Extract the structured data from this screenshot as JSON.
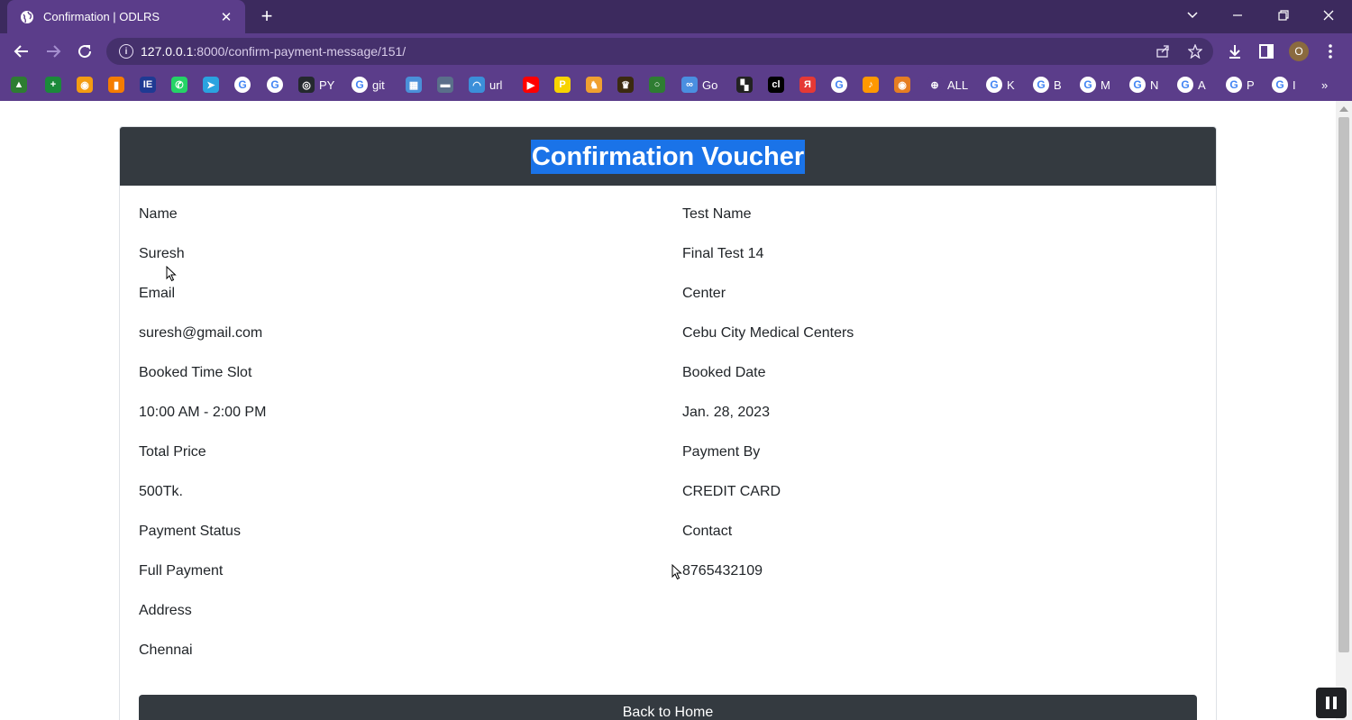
{
  "browser": {
    "tab": {
      "title": "Confirmation | ODLRS",
      "close_label": "✕"
    },
    "new_tab_label": "+",
    "url": {
      "host": "127.0.0.1",
      "path": ":8000/confirm-payment-message/151/"
    },
    "profile_initial": "O",
    "bookmarks": [
      {
        "label": "",
        "color": "#2e7d32",
        "glyph": "▲"
      },
      {
        "label": "",
        "color": "#1b8a3a",
        "glyph": "+"
      },
      {
        "label": "",
        "color": "#f39c12",
        "glyph": "◉"
      },
      {
        "label": "",
        "color": "#f57c00",
        "glyph": "▮"
      },
      {
        "label": "",
        "color": "#1f3a93",
        "glyph": "IE"
      },
      {
        "label": "",
        "color": "#25d366",
        "glyph": "✆"
      },
      {
        "label": "",
        "color": "#2aa3e0",
        "glyph": "➤"
      },
      {
        "label": "",
        "color": "g",
        "glyph": "G"
      },
      {
        "label": "",
        "color": "g",
        "glyph": "G"
      },
      {
        "label": "PY",
        "color": "#24292e",
        "glyph": "◎"
      },
      {
        "label": "git",
        "color": "g",
        "glyph": "G"
      },
      {
        "label": "",
        "color": "#4a90d9",
        "glyph": "▦"
      },
      {
        "label": "",
        "color": "#5a6f8a",
        "glyph": "▬"
      },
      {
        "label": "url",
        "color": "#3b8fd9",
        "glyph": "◠"
      },
      {
        "label": "",
        "color": "#ff0000",
        "glyph": "▶"
      },
      {
        "label": "",
        "color": "#f7d300",
        "glyph": "P"
      },
      {
        "label": "",
        "color": "#f0a030",
        "glyph": "♞"
      },
      {
        "label": "",
        "color": "#3b2a10",
        "glyph": "♛"
      },
      {
        "label": "",
        "color": "#2e7d32",
        "glyph": "○"
      },
      {
        "label": "Go",
        "color": "#4a8fe0",
        "glyph": "∞"
      },
      {
        "label": "",
        "color": "#222222",
        "glyph": "▚"
      },
      {
        "label": "",
        "color": "#000000",
        "glyph": "cl"
      },
      {
        "label": "",
        "color": "#e53935",
        "glyph": "Я"
      },
      {
        "label": "",
        "color": "g",
        "glyph": "G"
      },
      {
        "label": "",
        "color": "#ff9800",
        "glyph": "♪"
      },
      {
        "label": "",
        "color": "#e67e22",
        "glyph": "◉"
      },
      {
        "label": "ALL",
        "color": "#5b3d8a",
        "glyph": "⊕"
      },
      {
        "label": "K",
        "color": "g",
        "glyph": "G"
      },
      {
        "label": "B",
        "color": "g",
        "glyph": "G"
      },
      {
        "label": "M",
        "color": "g",
        "glyph": "G"
      },
      {
        "label": "N",
        "color": "g",
        "glyph": "G"
      },
      {
        "label": "A",
        "color": "g",
        "glyph": "G"
      },
      {
        "label": "P",
        "color": "g",
        "glyph": "G"
      },
      {
        "label": "I",
        "color": "g",
        "glyph": "G"
      }
    ],
    "overflow_label": "»"
  },
  "voucher": {
    "title": "Confirmation Voucher",
    "rows": [
      {
        "left": "Name",
        "right": "Test Name"
      },
      {
        "left": "Suresh",
        "right": "Final Test 14"
      },
      {
        "left": "Email",
        "right": "Center"
      },
      {
        "left": "suresh@gmail.com",
        "right": "Cebu City Medical Centers"
      },
      {
        "left": "Booked Time Slot",
        "right": "Booked Date"
      },
      {
        "left": "10:00 AM - 2:00 PM",
        "right": "Jan. 28, 2023"
      },
      {
        "left": "Total Price",
        "right": "Payment By"
      },
      {
        "left": "500Tk.",
        "right": "CREDIT CARD"
      },
      {
        "left": "Payment Status",
        "right": "Contact"
      },
      {
        "left": "Full Payment",
        "right": "8765432109"
      },
      {
        "left": "Address",
        "right": ""
      },
      {
        "left": "Chennai",
        "right": ""
      }
    ],
    "back_button": "Back to Home"
  },
  "colors": {
    "chrome_purple": "#5b3d8a",
    "header_dark": "#343a40",
    "selection_blue": "#1a73e8"
  }
}
